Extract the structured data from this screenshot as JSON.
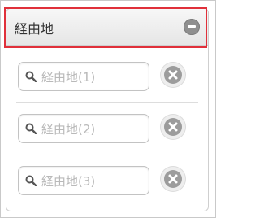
{
  "header": {
    "title": "経由地",
    "collapse_icon": "minus-circle-icon"
  },
  "waypoints": [
    {
      "placeholder": "経由地(1)",
      "search_icon": "search-icon",
      "clear_icon": "clear-icon"
    },
    {
      "placeholder": "経由地(2)",
      "search_icon": "search-icon",
      "clear_icon": "clear-icon"
    },
    {
      "placeholder": "経由地(3)",
      "search_icon": "search-icon",
      "clear_icon": "clear-icon"
    }
  ],
  "colors": {
    "highlight": "#e0303a",
    "placeholder": "#b9b9b9",
    "icon_gray": "#9c9c9c"
  }
}
